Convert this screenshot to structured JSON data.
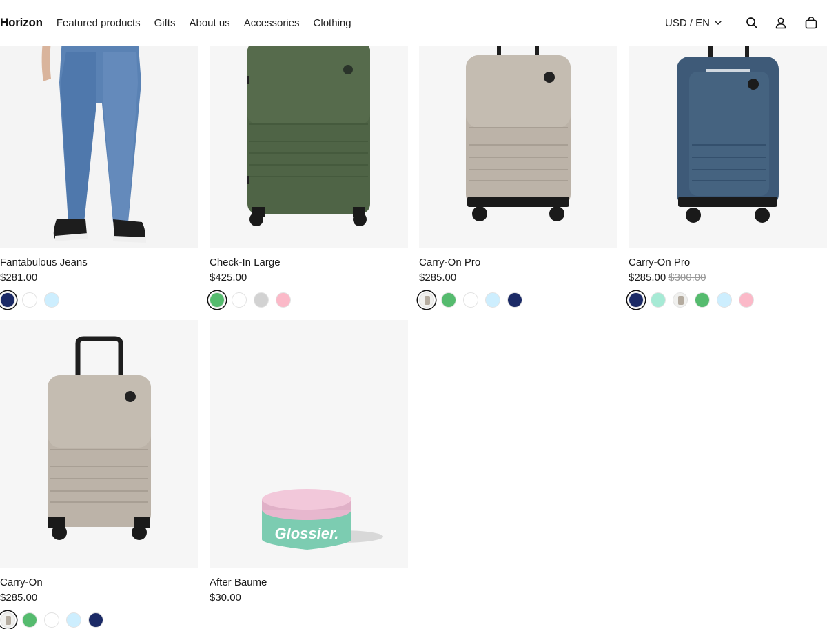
{
  "header": {
    "logo": "Horizon",
    "nav": [
      "Featured products",
      "Gifts",
      "About us",
      "Accessories",
      "Clothing"
    ],
    "locale": "USD / EN"
  },
  "products": [
    {
      "title": "Fantabulous Jeans",
      "price": "$281.00",
      "compare_price": "",
      "swatches": [
        {
          "color": "#1b2a66",
          "selected": true
        },
        {
          "color": "#ffffff",
          "selected": false
        },
        {
          "color": "#cdeefe",
          "selected": false
        }
      ]
    },
    {
      "title": "Check-In Large",
      "price": "$425.00",
      "compare_price": "",
      "swatches": [
        {
          "color": "#55bb6e",
          "selected": true
        },
        {
          "color": "#ffffff",
          "selected": false
        },
        {
          "color": "#d2d2d2",
          "selected": false
        },
        {
          "color": "#fbb9c8",
          "selected": false
        }
      ]
    },
    {
      "title": "Carry-On Pro",
      "price": "$285.00",
      "compare_price": "",
      "swatches": [
        {
          "color": "thumb",
          "selected": true
        },
        {
          "color": "#55bb6e",
          "selected": false
        },
        {
          "color": "#ffffff",
          "selected": false
        },
        {
          "color": "#cdeefe",
          "selected": false
        },
        {
          "color": "#1b2a66",
          "selected": false
        }
      ]
    },
    {
      "title": "Carry-On Pro",
      "price": "$285.00",
      "compare_price": "$300.00",
      "swatches": [
        {
          "color": "#1b2a66",
          "selected": true
        },
        {
          "color": "#a6ead5",
          "selected": false
        },
        {
          "color": "thumb",
          "selected": false
        },
        {
          "color": "#55bb6e",
          "selected": false
        },
        {
          "color": "#cdeefe",
          "selected": false
        },
        {
          "color": "#fbb9c8",
          "selected": false
        }
      ]
    },
    {
      "title": "Carry-On",
      "price": "$285.00",
      "compare_price": "",
      "swatches": [
        {
          "color": "thumb",
          "selected": true
        },
        {
          "color": "#55bb6e",
          "selected": false
        },
        {
          "color": "#ffffff",
          "selected": false
        },
        {
          "color": "#cdeefe",
          "selected": false
        },
        {
          "color": "#1b2a66",
          "selected": false
        }
      ]
    },
    {
      "title": "After Baume",
      "price": "$30.00",
      "compare_price": "",
      "swatches": [],
      "product_brand_text": "Glossier."
    }
  ]
}
